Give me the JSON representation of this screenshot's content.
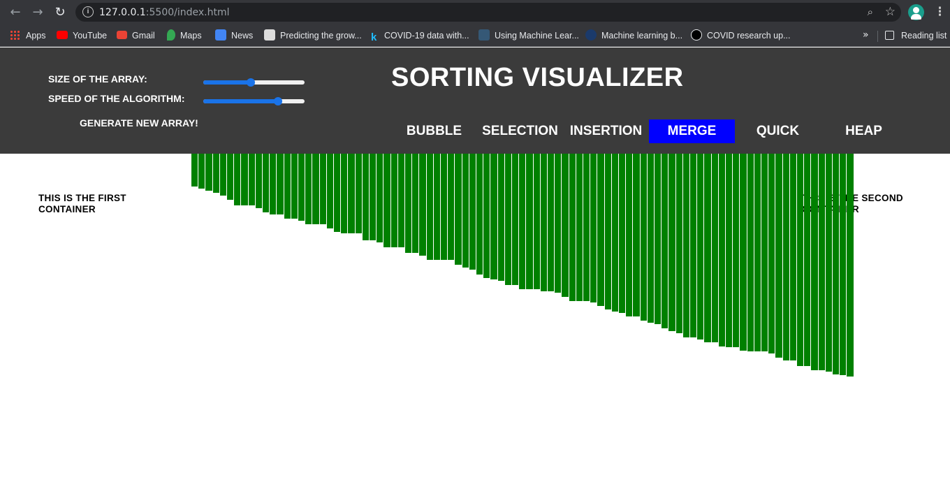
{
  "browser": {
    "url_host": "127.0.0.1",
    "url_rest": ":5500/index.html",
    "bookmarks": [
      {
        "label": "Apps",
        "icon": "apps-grid-icon"
      },
      {
        "label": "YouTube",
        "icon": "youtube-icon",
        "color": "#ff0000"
      },
      {
        "label": "Gmail",
        "icon": "gmail-icon",
        "color": "#ea4335"
      },
      {
        "label": "Maps",
        "icon": "maps-icon",
        "color": "#34a853"
      },
      {
        "label": "News",
        "icon": "news-icon",
        "color": "#4285f4"
      },
      {
        "label": "Predicting the grow...",
        "icon": "page-icon",
        "color": "#dddddd"
      },
      {
        "label": "COVID-19 data with...",
        "icon": "kaggle-icon",
        "color": "#20beff"
      },
      {
        "label": "Using Machine Lear...",
        "icon": "tds-icon",
        "color": "#355876"
      },
      {
        "label": "Machine learning b...",
        "icon": "nature-icon",
        "color": "#1b3a6b"
      },
      {
        "label": "COVID research up...",
        "icon": "n-icon",
        "color": "#000000"
      }
    ],
    "more": "»",
    "reading_list": "Reading list"
  },
  "controls": {
    "size_label": "SIZE OF THE ARRAY:",
    "speed_label": "SPEED OF THE ALGORITHM:",
    "size_value": 0.47,
    "speed_value": 0.74,
    "generate_label": "GENERATE NEW ARRAY!"
  },
  "title": "SORTING VISUALIZER",
  "algorithms": [
    {
      "label": "BUBBLE",
      "active": false
    },
    {
      "label": "SELECTION",
      "active": false
    },
    {
      "label": "INSERTION",
      "active": false
    },
    {
      "label": "MERGE",
      "active": true
    },
    {
      "label": "QUICK",
      "active": false
    },
    {
      "label": "HEAP",
      "active": false
    }
  ],
  "accent_color": "#0000ff",
  "bar_color": "#008000",
  "first_container_label": "THIS IS THE FIRST CONTAINER",
  "second_container_label": "THIS IS THE SECOND CONTAINER",
  "array": [
    44,
    47,
    50,
    53,
    57,
    62,
    70,
    70,
    70,
    74,
    79,
    82,
    82,
    88,
    88,
    91,
    95,
    95,
    95,
    101,
    106,
    108,
    108,
    108,
    117,
    117,
    120,
    126,
    126,
    126,
    134,
    134,
    138,
    143,
    143,
    143,
    143,
    150,
    154,
    157,
    163,
    168,
    170,
    172,
    177,
    177,
    183,
    183,
    183,
    186,
    186,
    188,
    193,
    199,
    199,
    199,
    201,
    206,
    210,
    213,
    215,
    220,
    220,
    225,
    228,
    230,
    236,
    240,
    242,
    248,
    248,
    251,
    255,
    255,
    260,
    261,
    261,
    266,
    267,
    267,
    267,
    270,
    275,
    279,
    279,
    287,
    287,
    292,
    292,
    294,
    298,
    299,
    301
  ]
}
